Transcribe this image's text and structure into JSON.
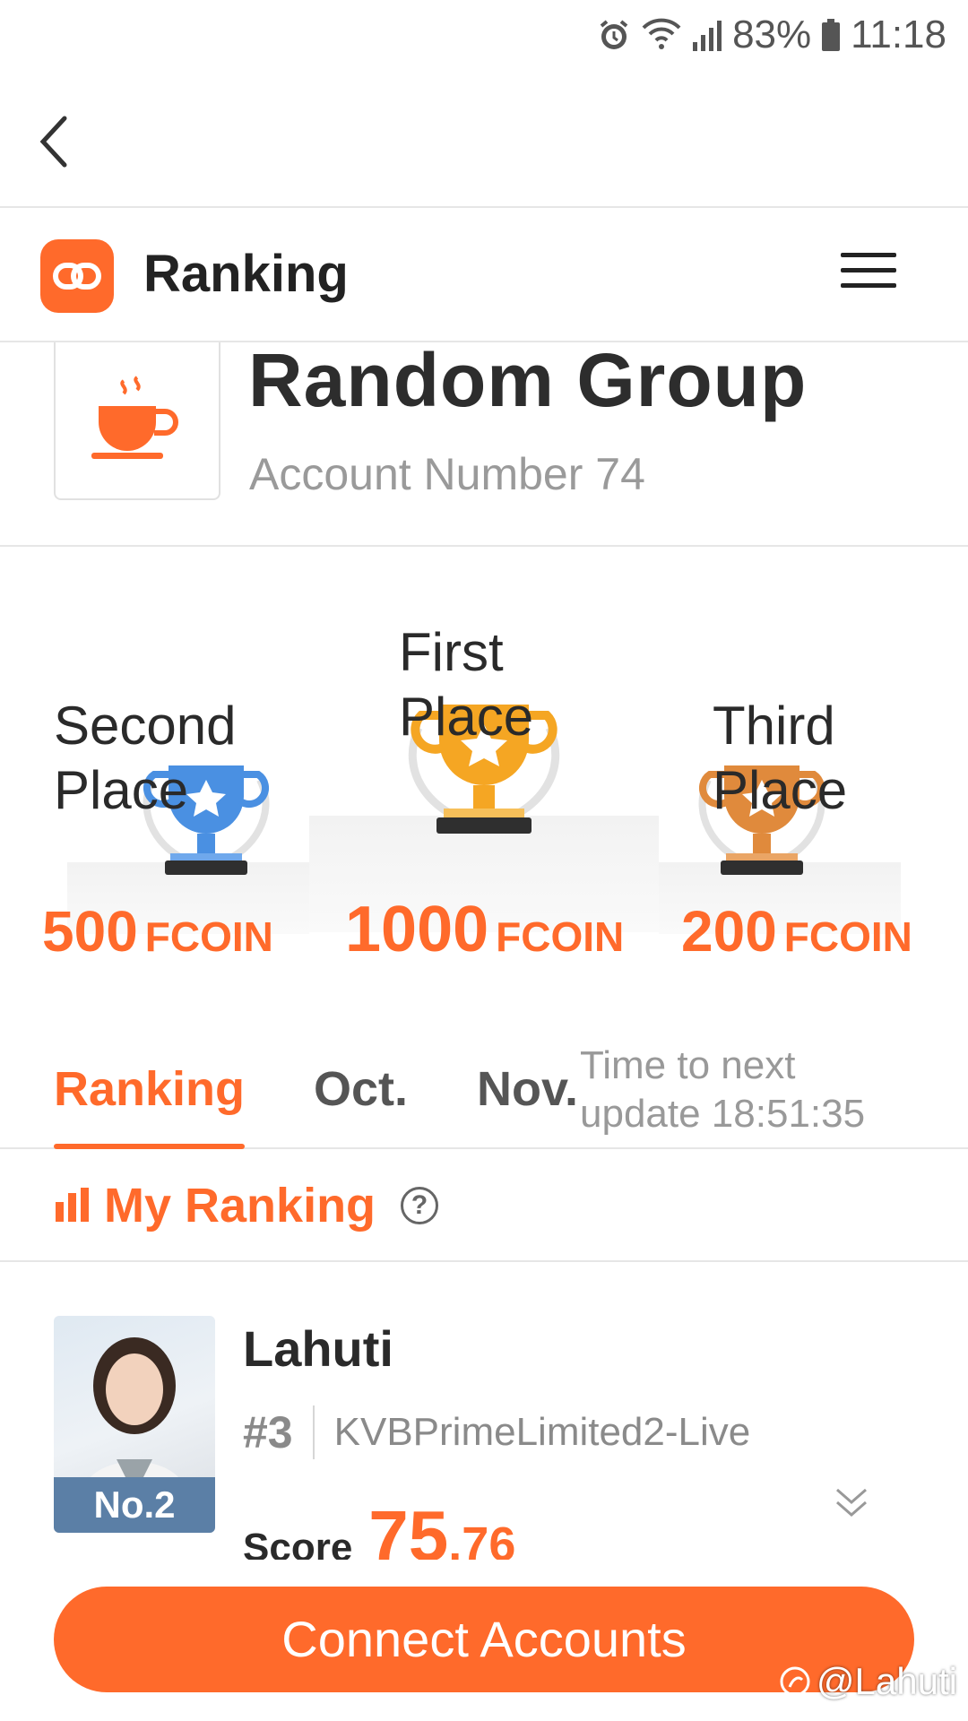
{
  "status_bar": {
    "battery": "83%",
    "time": "11:18"
  },
  "app_title": "Ranking",
  "group": {
    "name": "Random Group",
    "subtitle": "Account Number 74"
  },
  "podium": {
    "first": {
      "label": "First Place",
      "amount": "1000",
      "unit": "FCOIN"
    },
    "second": {
      "label": "Second Place",
      "amount": "500",
      "unit": "FCOIN"
    },
    "third": {
      "label": "Third Place",
      "amount": "200",
      "unit": "FCOIN"
    }
  },
  "tabs": [
    {
      "label": "Ranking",
      "active": true
    },
    {
      "label": "Oct."
    },
    {
      "label": "Nov."
    }
  ],
  "update_info": {
    "line1": "Time to next",
    "line2": "update 18:51:35"
  },
  "my_ranking": {
    "title": "My Ranking",
    "help": "?"
  },
  "entry": {
    "name": "Lahuti",
    "badge": "No.2",
    "position": "#3",
    "account": "KVBPrimeLimited2-Live",
    "score_label": "Score",
    "score_int": "75",
    "score_dec": ".76"
  },
  "connect_button": "Connect Accounts",
  "watermark": "@Lahuti",
  "colors": {
    "accent": "#ff6a2b",
    "badge": "#5b7fa6",
    "gold": "#f5a623",
    "silver_blue": "#4a90e2",
    "bronze": "#e08a3c"
  }
}
